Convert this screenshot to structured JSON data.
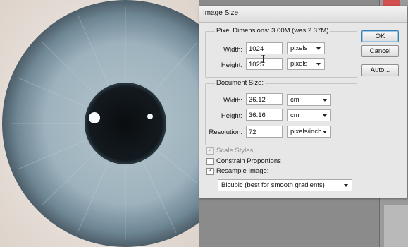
{
  "dialog": {
    "title": "Image Size",
    "buttons": {
      "ok": "OK",
      "cancel": "Cancel",
      "auto": "Auto..."
    }
  },
  "pixel_dimensions": {
    "legend": "Pixel Dimensions:  3.00M (was 2.37M)",
    "width_label": "Width:",
    "width_value": "1024",
    "width_unit": "pixels",
    "height_label": "Height:",
    "height_value": "1025",
    "height_unit": "pixels"
  },
  "document_size": {
    "legend": "Document Size:",
    "width_label": "Width:",
    "width_value": "36.12",
    "width_unit": "cm",
    "height_label": "Height:",
    "height_value": "36.16",
    "height_unit": "cm",
    "resolution_label": "Resolution:",
    "resolution_value": "72",
    "resolution_unit": "pixels/inch"
  },
  "options": {
    "scale_styles": {
      "label": "Scale Styles",
      "checked": true,
      "enabled": false
    },
    "constrain_proportions": {
      "label": "Constrain Proportions",
      "checked": false,
      "enabled": true
    },
    "resample_image": {
      "label": "Resample Image:",
      "checked": true,
      "enabled": true
    },
    "resample_method": "Bicubic (best for smooth gradients)"
  },
  "colors": {
    "iris": "#8fa7b4",
    "pupil": "#0d1114",
    "accent_close": "#d25050"
  }
}
